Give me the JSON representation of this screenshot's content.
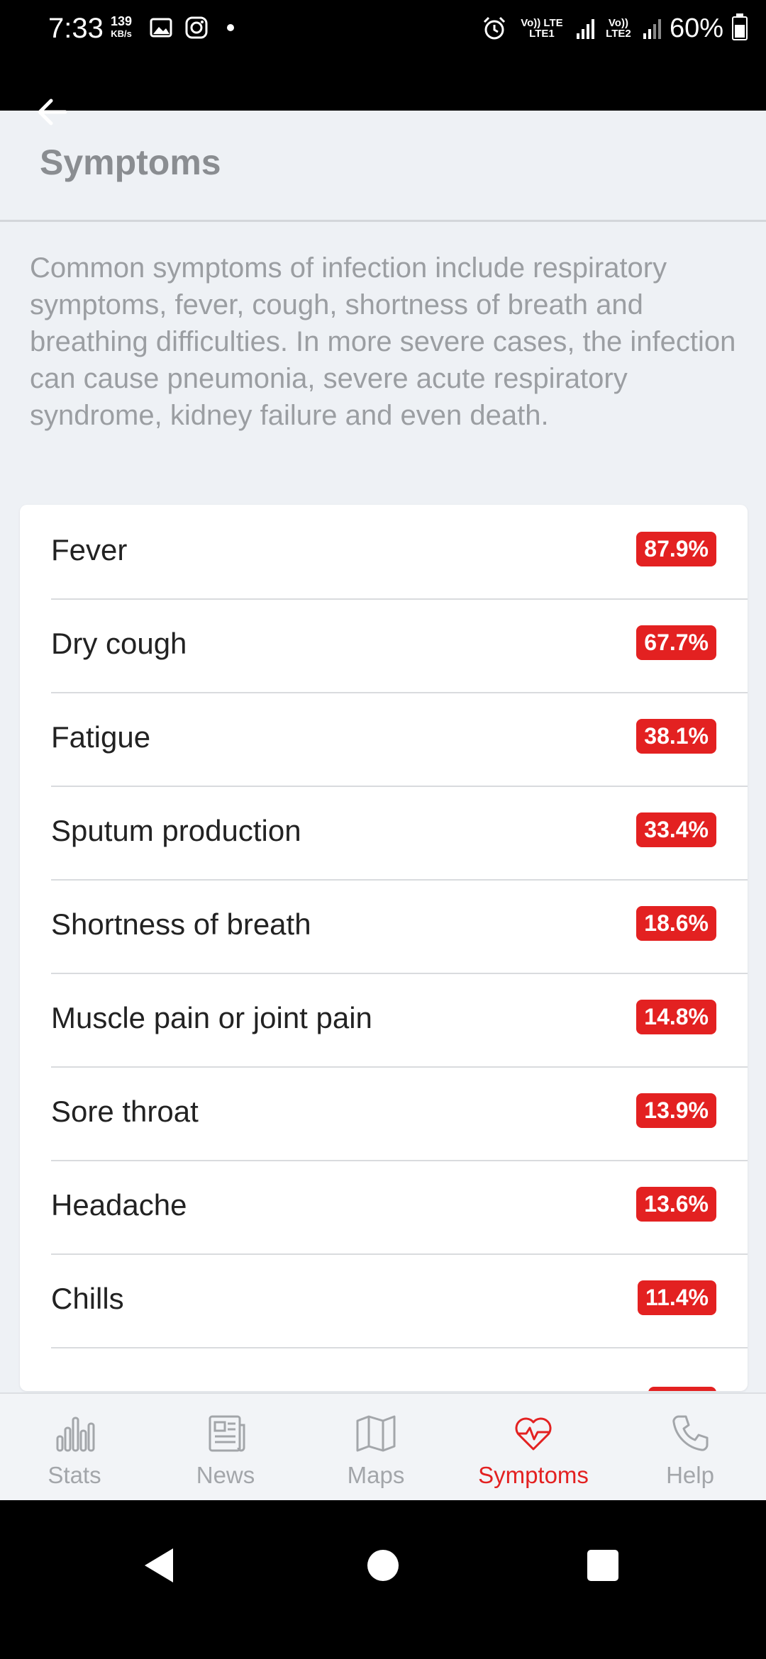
{
  "status_bar": {
    "time": "7:33",
    "speed_value": "139",
    "speed_unit": "KB/s",
    "sim1": "Vo)) LTE LTE1",
    "sim2": "Vo)) LTE2",
    "battery": "60%"
  },
  "header": {
    "title": "Symptoms"
  },
  "intro_text": "Common symptoms of infection include respiratory symptoms, fever, cough, shortness of breath and breathing difficulties. In more severe cases, the infection can cause pneumonia, severe acute respiratory syndrome, kidney failure and even death.",
  "symptoms": [
    {
      "name": "Fever",
      "percent": "87.9%"
    },
    {
      "name": "Dry cough",
      "percent": "67.7%"
    },
    {
      "name": "Fatigue",
      "percent": "38.1%"
    },
    {
      "name": "Sputum production",
      "percent": "33.4%"
    },
    {
      "name": "Shortness of breath",
      "percent": "18.6%"
    },
    {
      "name": "Muscle pain or joint pain",
      "percent": "14.8%"
    },
    {
      "name": "Sore throat",
      "percent": "13.9%"
    },
    {
      "name": "Headache",
      "percent": "13.6%"
    },
    {
      "name": "Chills",
      "percent": "11.4%"
    }
  ],
  "nav": [
    {
      "label": "Stats",
      "icon": "bar-chart-icon"
    },
    {
      "label": "News",
      "icon": "newspaper-icon"
    },
    {
      "label": "Maps",
      "icon": "map-icon"
    },
    {
      "label": "Symptoms",
      "icon": "heartbeat-icon",
      "active": true
    },
    {
      "label": "Help",
      "icon": "phone-icon"
    }
  ],
  "colors": {
    "accent": "#e32121",
    "inactive": "#a3a6aa",
    "background": "#eef1f5"
  }
}
